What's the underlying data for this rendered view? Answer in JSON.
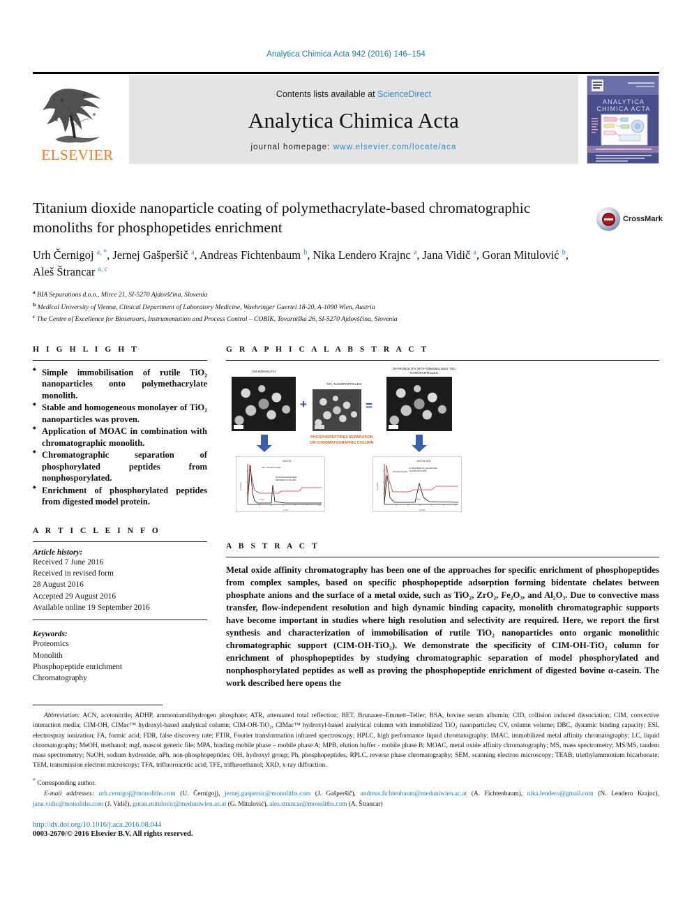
{
  "running_head": "Analytica Chimica Acta 942 (2016) 146–154",
  "masthead": {
    "publisher": "ELSEVIER",
    "contents_prefix": "Contents lists available at ",
    "contents_link": "ScienceDirect",
    "journal_title": "Analytica Chimica Acta",
    "homepage_prefix": "journal homepage: ",
    "homepage_url": "www.elsevier.com/locate/aca",
    "cover_journal_line1": "ANALYTICA",
    "cover_journal_line2": "CHIMICA ACTA"
  },
  "article": {
    "title": "Titanium dioxide nanoparticle coating of polymethacrylate-based chromatographic monoliths for phosphopetides enrichment",
    "authors_line1": "Urh Černigoj",
    "authors_html": "Urh Černigoj <sup>a, *</sup>, Jernej Gašperšič <sup>a</sup>, Andreas Fichtenbaum <sup>b</sup>, Nika Lendero Krajnc <sup>a</sup>, Jana Vidič <sup>a</sup>, Goran Mitulović <sup>b</sup>, Aleš Štrancar <sup>a, c</sup>",
    "affiliations": [
      {
        "marker": "a",
        "text": "BIA Separations d.o.o., Mirce 21, SI-5270 Ajdovščina, Slovenia"
      },
      {
        "marker": "b",
        "text": "Medical University of Vienna, Clinical Department of Laboratory Medicine, Waehringer Guertel 18-20, A-1090 Wien, Austria"
      },
      {
        "marker": "c",
        "text": "The Centre of Excellence for Biosensors, Instrumentation and Process Control – COBIK, Tovarniška 26, SI-5270 Ajdovščina, Slovenia"
      }
    ],
    "crossmark_label": "CrossMark"
  },
  "sections": {
    "highlight_heading": "H I G H L I G H T",
    "graphical_abstract_heading": "G R A P H I C A L   A B S T R A C T",
    "article_info_heading": "A R T I C L E   I N F O",
    "abstract_heading": "A B S T R A C T"
  },
  "highlights": [
    "Simple immobilisation of rutile TiO₂ nanoparticles onto polymethacrylate monolith.",
    "Stable and homogeneous monolayer of TiO₂ nanoparticles was proven.",
    "Application of MOAC in combination with chromatographic monolith.",
    "Chromatographic separation of phosphorylated peptides from nonphosporylated.",
    "Enrichment of phosphorylated peptides from digested model protein."
  ],
  "article_info": {
    "history_label": "Article history:",
    "history": [
      "Received 7 June 2016",
      "Received in revised form",
      "28 August 2016",
      "Accepted 29 August 2016",
      "Available online 19 September 2016"
    ],
    "keywords_label": "Keywords:",
    "keywords": [
      "Proteomics",
      "Monolith",
      "Phosphopeptide enrichment",
      "Chromatography"
    ]
  },
  "abstract": "Metal oxide affinity chromatography has been one of the approaches for specific enrichment of phosphopeptides from complex samples, based on specific phosphopeptide adsorption forming bidentate chelates between phosphate anions and the surface of a metal oxide, such as TiO₂, ZrO₂, Fe₂O₃, and Al₂O₃. Due to convective mass transfer, flow-independent resolution and high dynamic binding capacity, monolith chromatographic supports have become important in studies where high resolution and selectivity are required. Here, we report the first synthesis and characterization of immobilisation of rutile TiO₂ nanoparticles onto organic monolithic chromatographic support (CIM-OH-TiO₂). We demonstrate the specificity of CIM-OH-TiO₂ column for enrichment of phosphopeptides by studying chromatographic separation of model phosphorylated and nonphosphorylated peptides as well as proving the phosphopeptide enrichment of digested bovine α-casein. The work described here opens the",
  "graphical_abstract": {
    "label_monolith": "OH-MONOLITH",
    "label_nanoparticles": "TiO₂ NANOPARTICLES",
    "label_composite": "OH-MONOLITH WITH IMMOBILISED TiO₂ NANOPARTICLES",
    "plus": "+",
    "equals": "=",
    "center_label_line1": "PHOSPHOPEPTIDES SEPARATION",
    "center_label_line2": "ON CHROMATOGRAPHIC COLUMN",
    "chart_left_title": "CIM-OH",
    "chart_right_title": "CIM-OH-TiO₂",
    "chart_axis_y": "A (mAU)",
    "chart_axis_x": "t (min)"
  },
  "footnotes": {
    "abbrev_label": "Abbreviation:",
    "abbrev_text": " ACN, acetonitrile; ADHP, ammoniumdihydrogen phosphate; ATR, attenuated total reflection; BET, Brunauer–Emmett–Teller; BSA, bovine serum albumin; CID, collision induced dissociation; CIM, convective interaction media; CIM-OH, CIMac™ hydroxyl-based analytical column; CIM-OH-TiO₂, CIMac™ hydroxyl-based analytical column with immobilized TiO₂ nanoparticles; CV, column volume; DBC, dynamic binding capacity; ESI, electrospray ionization; FA, formic acid; FDR, false discovery rate; FTIR, Fourier transformation infrared spectroscopy; HPLC, high performance liquid chromatography; IMAC, immobilized metal affinity chromatography; LC, liquid chromatography; MeOH, methanol; mgf, mascot generic file; MPA, binding mobile phase – mobile phase A; MPB, elution buffer - mobile phase B; MOAC, metal oxide affinity chromatography; MS, mass spectrometry; MS/MS, tandem mass spectrometry; NaOH, sodium hydroxide; nPh, non-phosphopeptides; OH, hydroxyl group; Ph, phosphopeptides; RPLC, reverse phase chromatography; SEM, scanning electron microscopy; TEAB, triethylammonium bicarbonate; TEM, transmission electron microscopy; TFA, trifluoroacetic acid; TFE, trifluroethanol; XRD, x-ray diffraction.",
    "corresponding": "Corresponding author.",
    "email_label": "E-mail addresses:",
    "emails": [
      {
        "address": "urh.cernigoj@monoliths.com",
        "person": "(U. Černigoj)"
      },
      {
        "address": "jernej.gaspersic@monoliths.com",
        "person": "(J. Gašperšič)"
      },
      {
        "address": "andreas.fichtenbaum@meduniwien.ac.at",
        "person": "(A. Fichtenbaum)"
      },
      {
        "address": "nika.lendero@gmail.com",
        "person": "(N. Lendero Krajnc)"
      },
      {
        "address": "jana.vidic@monoliths.com",
        "person": "(J. Vidič)"
      },
      {
        "address": "goran.mitulovic@meduniwien.ac.at",
        "person": "(G. Mitulović)"
      },
      {
        "address": "ales.strancar@monoliths.com",
        "person": "(A. Štrancar)"
      }
    ],
    "doi": "http://dx.doi.org/10.1016/j.aca.2016.08.044",
    "copyright": "0003-2670/© 2016 Elsevier B.V. All rights reserved."
  }
}
